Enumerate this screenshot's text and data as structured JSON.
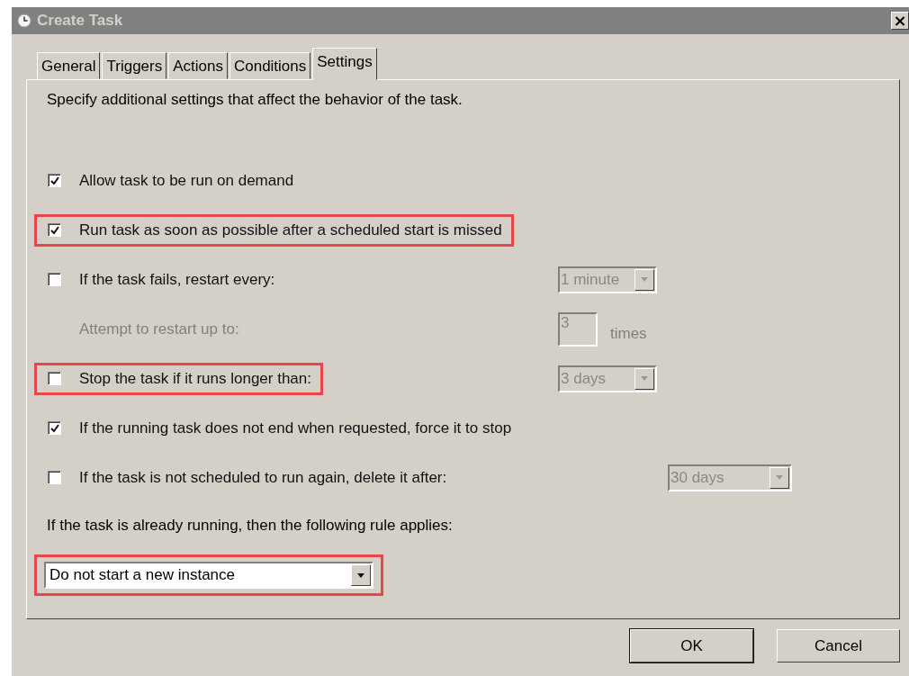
{
  "window": {
    "title": "Create Task",
    "close": "×"
  },
  "tabs": [
    {
      "label": "General",
      "selected": false
    },
    {
      "label": "Triggers",
      "selected": false
    },
    {
      "label": "Actions",
      "selected": false
    },
    {
      "label": "Conditions",
      "selected": false
    },
    {
      "label": "Settings",
      "selected": true
    }
  ],
  "intro": "Specify additional settings that affect the behavior of the task.",
  "options": [
    {
      "kind": "checkbox",
      "label": "Allow task to be run on demand",
      "checked": true,
      "highlighted": false
    },
    {
      "kind": "checkbox",
      "label": "Run task as soon as possible after a scheduled start is missed",
      "checked": true,
      "highlighted": true
    },
    {
      "kind": "checkbox",
      "label": "If the task fails, restart every:",
      "checked": false,
      "highlighted": false,
      "control": {
        "kind": "dropdown",
        "value": "1 minute",
        "disabled": true
      }
    },
    {
      "kind": "indent",
      "label": "Attempt to restart up to:",
      "disabled": true,
      "highlighted": false,
      "control": {
        "kind": "textbox",
        "value": "3",
        "suffix": "times",
        "disabled": true
      }
    },
    {
      "kind": "checkbox",
      "label": "Stop the task if it runs longer than:",
      "checked": false,
      "highlighted": true,
      "control": {
        "kind": "dropdown",
        "value": "3 days",
        "disabled": true
      }
    },
    {
      "kind": "checkbox",
      "label": "If the running task does not end when requested, force it to stop",
      "checked": true,
      "highlighted": false
    },
    {
      "kind": "checkbox",
      "label": "If the task is not scheduled to run again, delete it after:",
      "checked": false,
      "highlighted": false,
      "control": {
        "kind": "wide-dropdown",
        "value": "30 days",
        "disabled": true
      }
    }
  ],
  "rule": {
    "label": "If the task is already running, then the following rule applies:",
    "value": "Do not start a new instance",
    "highlighted": true
  },
  "buttons": [
    {
      "label": "OK",
      "default": true
    },
    {
      "label": "Cancel",
      "default": false
    }
  ]
}
